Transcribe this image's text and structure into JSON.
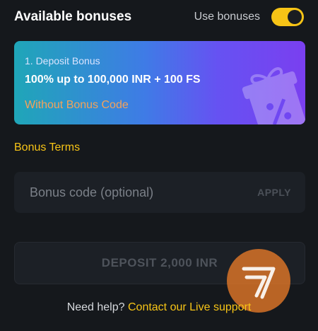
{
  "header": {
    "title": "Available bonuses",
    "toggle_label": "Use bonuses",
    "toggle_on": true
  },
  "bonus": {
    "index_label": "1. Deposit Bonus",
    "amount_label": "100% up to 100,000 INR + 100 FS",
    "code_note": "Without Bonus Code"
  },
  "terms_label": "Bonus Terms",
  "code_field": {
    "placeholder": "Bonus code (optional)",
    "value": "",
    "apply_label": "APPLY"
  },
  "deposit_label": "DEPOSIT 2,000 INR",
  "help": {
    "prefix": "Need help?",
    "link_label": "Contact our Live support"
  },
  "colors": {
    "accent": "#f7c416",
    "background": "#15181c",
    "field": "#1c2026",
    "code_note": "#f4a25a"
  },
  "icons": [
    "gift-icon",
    "brand-logo-icon"
  ]
}
